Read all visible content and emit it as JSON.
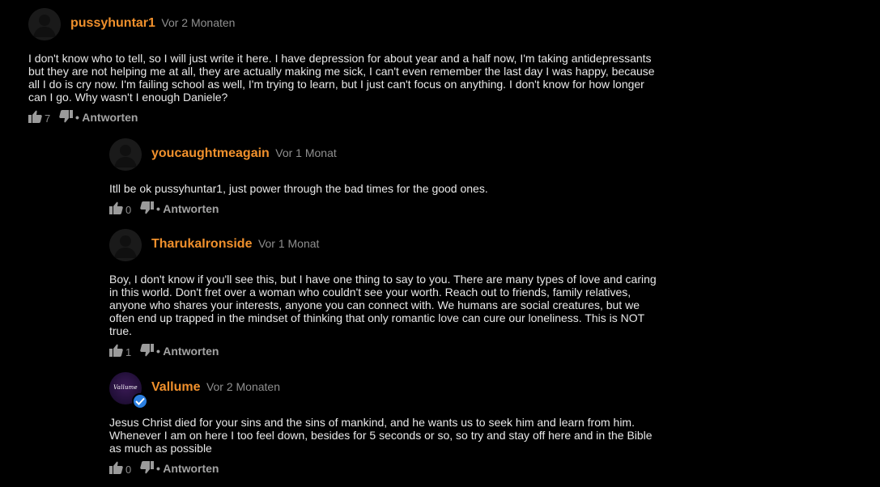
{
  "labels": {
    "reply": "• Antworten"
  },
  "colors": {
    "background": "#000000",
    "username": "#f0902c",
    "timeago": "#8f8f8f",
    "text": "#e8e8e8",
    "verified_badge": "#2b7fe0"
  },
  "icons": {
    "like": "thumbs-up-icon",
    "dislike": "thumbs-down-icon",
    "verified": "checkmark-icon",
    "avatar_default": "user-silhouette-icon"
  },
  "comments": [
    {
      "username": "pussyhuntar1",
      "time": "Vor 2 Monaten",
      "text": "I don't know who to tell, so I will just write it here. I have depression for about year and a half now, I'm taking antidepressants but they are not helping me at all, they are actually making me sick, I can't even remember the last day I was happy, because all I do is cry now. I'm failing school as well, I'm trying to learn, but I just can't focus on anything. I don't know for how longer can I go. Why wasn't I enough Daniele?",
      "likes": "7"
    },
    {
      "username": "youcaughtmeagain",
      "time": "Vor 1 Monat",
      "text": "Itll be ok pussyhuntar1, just power through the bad times for the good ones.",
      "likes": "0"
    },
    {
      "username": "TharukaIronside",
      "time": "Vor 1 Monat",
      "text": "Boy, I don't know if you'll see this, but I have one thing to say to you. There are many types of love and caring in this world. Don't fret over a woman who couldn't see your worth. Reach out to friends, family relatives, anyone who shares your interests, anyone you can connect with. We humans are social creatures, but we often end up trapped in the mindset of thinking that only romantic love can cure our loneliness. This is NOT true.",
      "likes": "1"
    },
    {
      "username": "Vallume",
      "time": "Vor 2 Monaten",
      "avatar_text": "Vallume",
      "verified": true,
      "text": "Jesus Christ died for your sins and the sins of mankind, and he wants us to seek him and learn from him. Whenever I am on here I too feel down, besides for 5 seconds or so, so try and stay off here and in the Bible as much as possible",
      "likes": "0"
    }
  ]
}
